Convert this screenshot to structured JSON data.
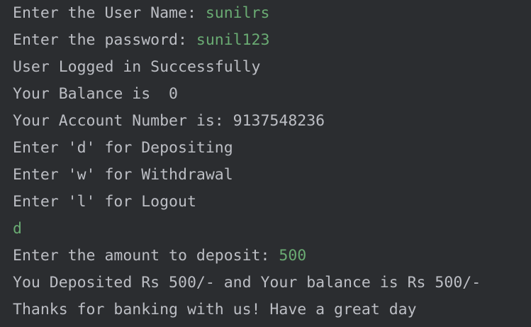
{
  "console": {
    "lines": [
      {
        "text": "Enter the User Name: ",
        "input": "sunilrs"
      },
      {
        "text": "Enter the password: ",
        "input": "sunil123"
      },
      {
        "text": "User Logged in Successfully",
        "input": ""
      },
      {
        "text": "Your Balance is  0",
        "input": ""
      },
      {
        "text": "Your Account Number is: 9137548236",
        "input": ""
      },
      {
        "text": "Enter 'd' for Depositing",
        "input": ""
      },
      {
        "text": "Enter 'w' for Withdrawal",
        "input": ""
      },
      {
        "text": "Enter 'l' for Logout",
        "input": ""
      },
      {
        "text": "",
        "input": "d"
      },
      {
        "text": "Enter the amount to deposit: ",
        "input": "500"
      },
      {
        "text": "You Deposited Rs 500/- and Your balance is Rs 500/-",
        "input": ""
      },
      {
        "text": "Thanks for banking with us! Have a great day",
        "input": ""
      }
    ]
  },
  "colors": {
    "background": "#2b2d30",
    "output_text": "#bcbec4",
    "user_input": "#6aab73"
  }
}
